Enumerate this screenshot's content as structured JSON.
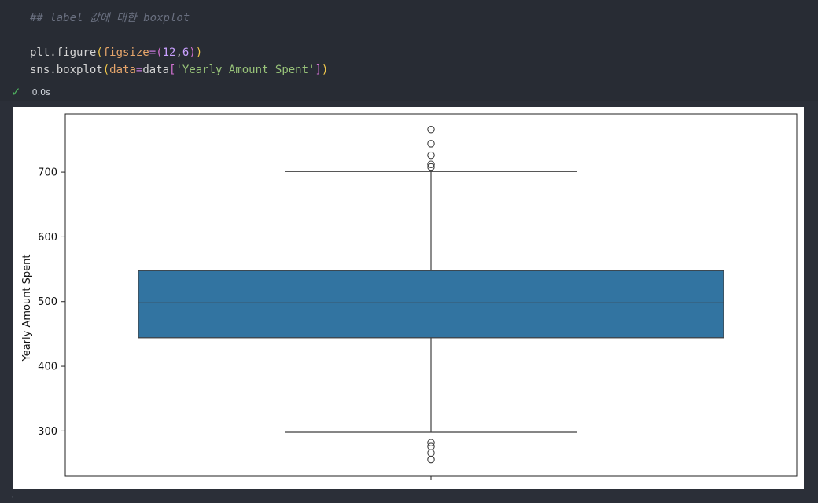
{
  "code": {
    "comment": "## label 값에 대한 boxplot",
    "line1": {
      "obj": "plt.figure",
      "param": "figsize",
      "eq": "=",
      "open": "(",
      "n1": "12",
      "comma": ",",
      "n2": "6",
      "close": ")"
    },
    "line2": {
      "obj": "sns.boxplot",
      "param": "data",
      "eq": "=",
      "var": "data",
      "key": "'Yearly Amount Spent'"
    }
  },
  "status": {
    "icon": "check-icon",
    "time": "0.0s",
    "color": "#4fb35f"
  },
  "chart_data": {
    "type": "boxplot",
    "ylabel": "Yearly Amount Spent",
    "ylim": [
      230,
      790
    ],
    "yticks": [
      300,
      400,
      500,
      600,
      700
    ],
    "yticklabels": [
      "300",
      "400",
      "500",
      "600",
      "700"
    ],
    "box_color": "#3274a1",
    "box": {
      "whisker_low": 298,
      "q1": 444,
      "median": 498,
      "q3": 548,
      "whisker_high": 701
    },
    "outliers": [
      766,
      744,
      726,
      712,
      708,
      282,
      276,
      266,
      256
    ]
  }
}
